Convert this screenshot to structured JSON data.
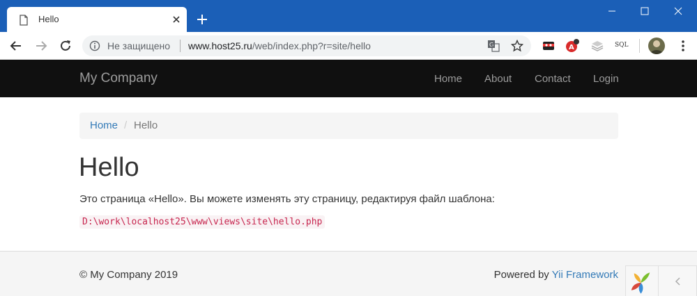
{
  "browser": {
    "tab_title": "Hello",
    "security_label": "Не защищено",
    "url_host": "www.host25.ru",
    "url_path": "/web/index.php?r=site/hello",
    "ext_sql_label": "SQL"
  },
  "site": {
    "brand": "My Company",
    "nav": [
      {
        "label": "Home"
      },
      {
        "label": "About"
      },
      {
        "label": "Contact"
      },
      {
        "label": "Login"
      }
    ],
    "breadcrumb": {
      "home": "Home",
      "separator": "/",
      "current": "Hello"
    },
    "title": "Hello",
    "text": "Это страница «Hello». Вы можете изменять эту страницу, редактируя файл шаблона:",
    "code_path": "D:\\work\\localhost25\\www\\views\\site\\hello.php",
    "footer": {
      "copyright": "© My Company 2019",
      "powered_prefix": "Powered by ",
      "powered_link": "Yii Framework"
    }
  },
  "colors": {
    "titlebar": "#1b5fb7",
    "navbar": "#101010",
    "link": "#337ab7",
    "code": "#c7254e"
  }
}
